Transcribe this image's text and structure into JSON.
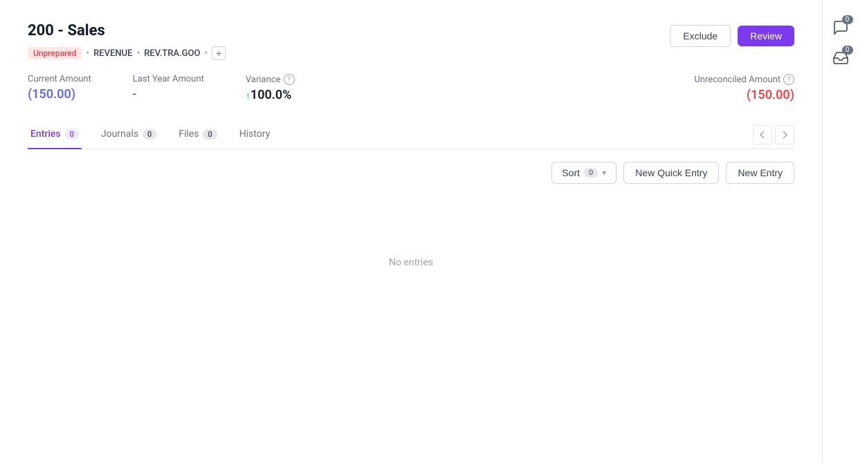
{
  "page": {
    "title": "200 - Sales",
    "status_tag": "Unprepared",
    "tag1": "REVENUE",
    "tag2": "REV.TRA.GOO",
    "metrics": {
      "current_amount_label": "Current Amount",
      "current_amount_value": "(150.00)",
      "last_year_label": "Last Year Amount",
      "last_year_value": "-",
      "variance_label": "Variance",
      "variance_value": "100.0%",
      "unreconciled_label": "Unreconciled Amount",
      "unreconciled_value": "(150.00)"
    },
    "tabs": [
      {
        "label": "Entries",
        "count": "0",
        "active": true
      },
      {
        "label": "Journals",
        "count": "0",
        "active": false
      },
      {
        "label": "Files",
        "count": "0",
        "active": false
      },
      {
        "label": "History",
        "count": null,
        "active": false
      }
    ],
    "toolbar": {
      "sort_label": "Sort",
      "sort_count": "0",
      "new_quick_entry_label": "New Quick Entry",
      "new_entry_label": "New Entry"
    },
    "empty_state": "No entries",
    "actions": {
      "exclude_label": "Exclude",
      "review_label": "Review"
    },
    "sidebar": {
      "chat_badge": "0",
      "inbox_badge": "0"
    }
  }
}
